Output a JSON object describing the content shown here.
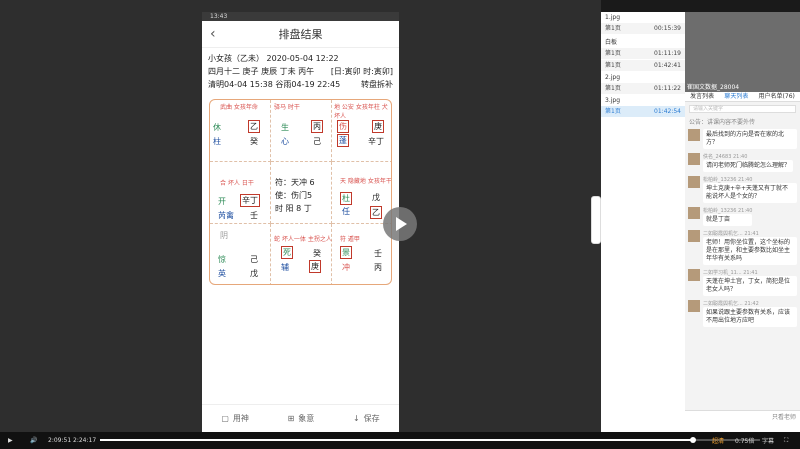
{
  "phone": {
    "status": "13:43",
    "title": "排盘结果",
    "line1": "小女孩（乙未） 2020-05-04 12:22",
    "line2a": "四月十二  庚子 庚辰 丁未 丙午",
    "line2b": "[日:寅卯 时:寅卯]",
    "line3a": "清明04-04 15:38 谷雨04-19 22:45",
    "line3b": "转盘拆补",
    "center1": "符：天冲 6",
    "center2": "使：伤门5",
    "center3": "时 阳 8 丁",
    "bottom_tabs": [
      "用神",
      "象意",
      "保存"
    ],
    "cells": [
      {
        "god": "休",
        "star": "柱",
        "gan": "乙",
        "gan2": "癸",
        "notes": "武曲 女孩年命"
      },
      {
        "god": "生",
        "star": "心",
        "gan": "丙",
        "gan2": "己",
        "notes": "驿马 时干"
      },
      {
        "god": "伤",
        "star": "蓬",
        "gan": "庚",
        "gan2": "辛丁",
        "notes": "地 公安 女孩年柱 犬坏人"
      },
      {
        "god": "开",
        "star": "芮禽",
        "gan": "辛丁",
        "gan2": "壬",
        "notes": "合 坏人 日干"
      },
      {
        "god": "任",
        "star": "杜",
        "gan": "乙",
        "gan2": "戊",
        "notes": "天 隐藏地 女孩年干"
      },
      {
        "god": "惊",
        "star": "英",
        "gan": "己",
        "gan2": "戊",
        "notes": "阴"
      },
      {
        "god": "死",
        "star": "辅",
        "gan": "癸",
        "gan2": "庚",
        "notes": "蛇 坏人一体 主拐之人"
      },
      {
        "god": "景",
        "star": "冲",
        "gan": "壬",
        "gan2": "丙",
        "notes": "符 遁甲"
      }
    ]
  },
  "pages": [
    {
      "section": "1.jpg",
      "items": [
        {
          "label": "第1页",
          "time": "00:15:39",
          "active": false
        }
      ]
    },
    {
      "section": "白板",
      "items": [
        {
          "label": "第1页",
          "time": "01:11:19",
          "active": false
        },
        {
          "label": "第1页",
          "time": "01:42:41",
          "active": false
        }
      ]
    },
    {
      "section": "2.jpg",
      "items": [
        {
          "label": "第1页",
          "time": "01:11:22",
          "active": false
        }
      ]
    },
    {
      "section": "3.jpg",
      "items": [
        {
          "label": "第1页",
          "time": "01:42:54",
          "active": true
        }
      ]
    }
  ],
  "chat": {
    "teacher": "崔国文数据_28004",
    "tabs": [
      "发言列表",
      "聊天列表",
      "用户名单(76)"
    ],
    "search_placeholder": "请输入关键字",
    "notice": "公告：讲课内容不要外传",
    "messages": [
      {
        "user": "",
        "time": "",
        "text": "最后找到的方向是否在家的北方？"
      },
      {
        "user": "佚名_24683",
        "time": "21:40",
        "text": "请问老师死门临腾蛇怎么理解？"
      },
      {
        "user": "松柏岭_13236",
        "time": "21:40",
        "text": "坤土克庚+辛+天蓬又有丁就不能说坏人是个女的？"
      },
      {
        "user": "松柏岭_13236",
        "time": "21:40",
        "text": "就是丁亩"
      },
      {
        "user": "二如聪霞舆机乞...",
        "time": "21:41",
        "text": "老师！用你坐位置，这个坐标的是在那里，和主要参数比如坐主年华有关系吗"
      },
      {
        "user": "二如学习机_11...",
        "time": "21:41",
        "text": "天蓬在坤土宫，丁女，简犯是位老女人吗？"
      },
      {
        "user": "二如聪霞舆机乞...",
        "time": "21:42",
        "text": "如果说跟主要参数有关系，应该不用出位地方应吧"
      }
    ],
    "footer": "只看老师"
  },
  "player": {
    "current": "2:09:51",
    "total": "2:24:17",
    "progress": 0.899,
    "speed_label": "超清",
    "rate": "0.75倍",
    "subtitle": "字幕"
  }
}
